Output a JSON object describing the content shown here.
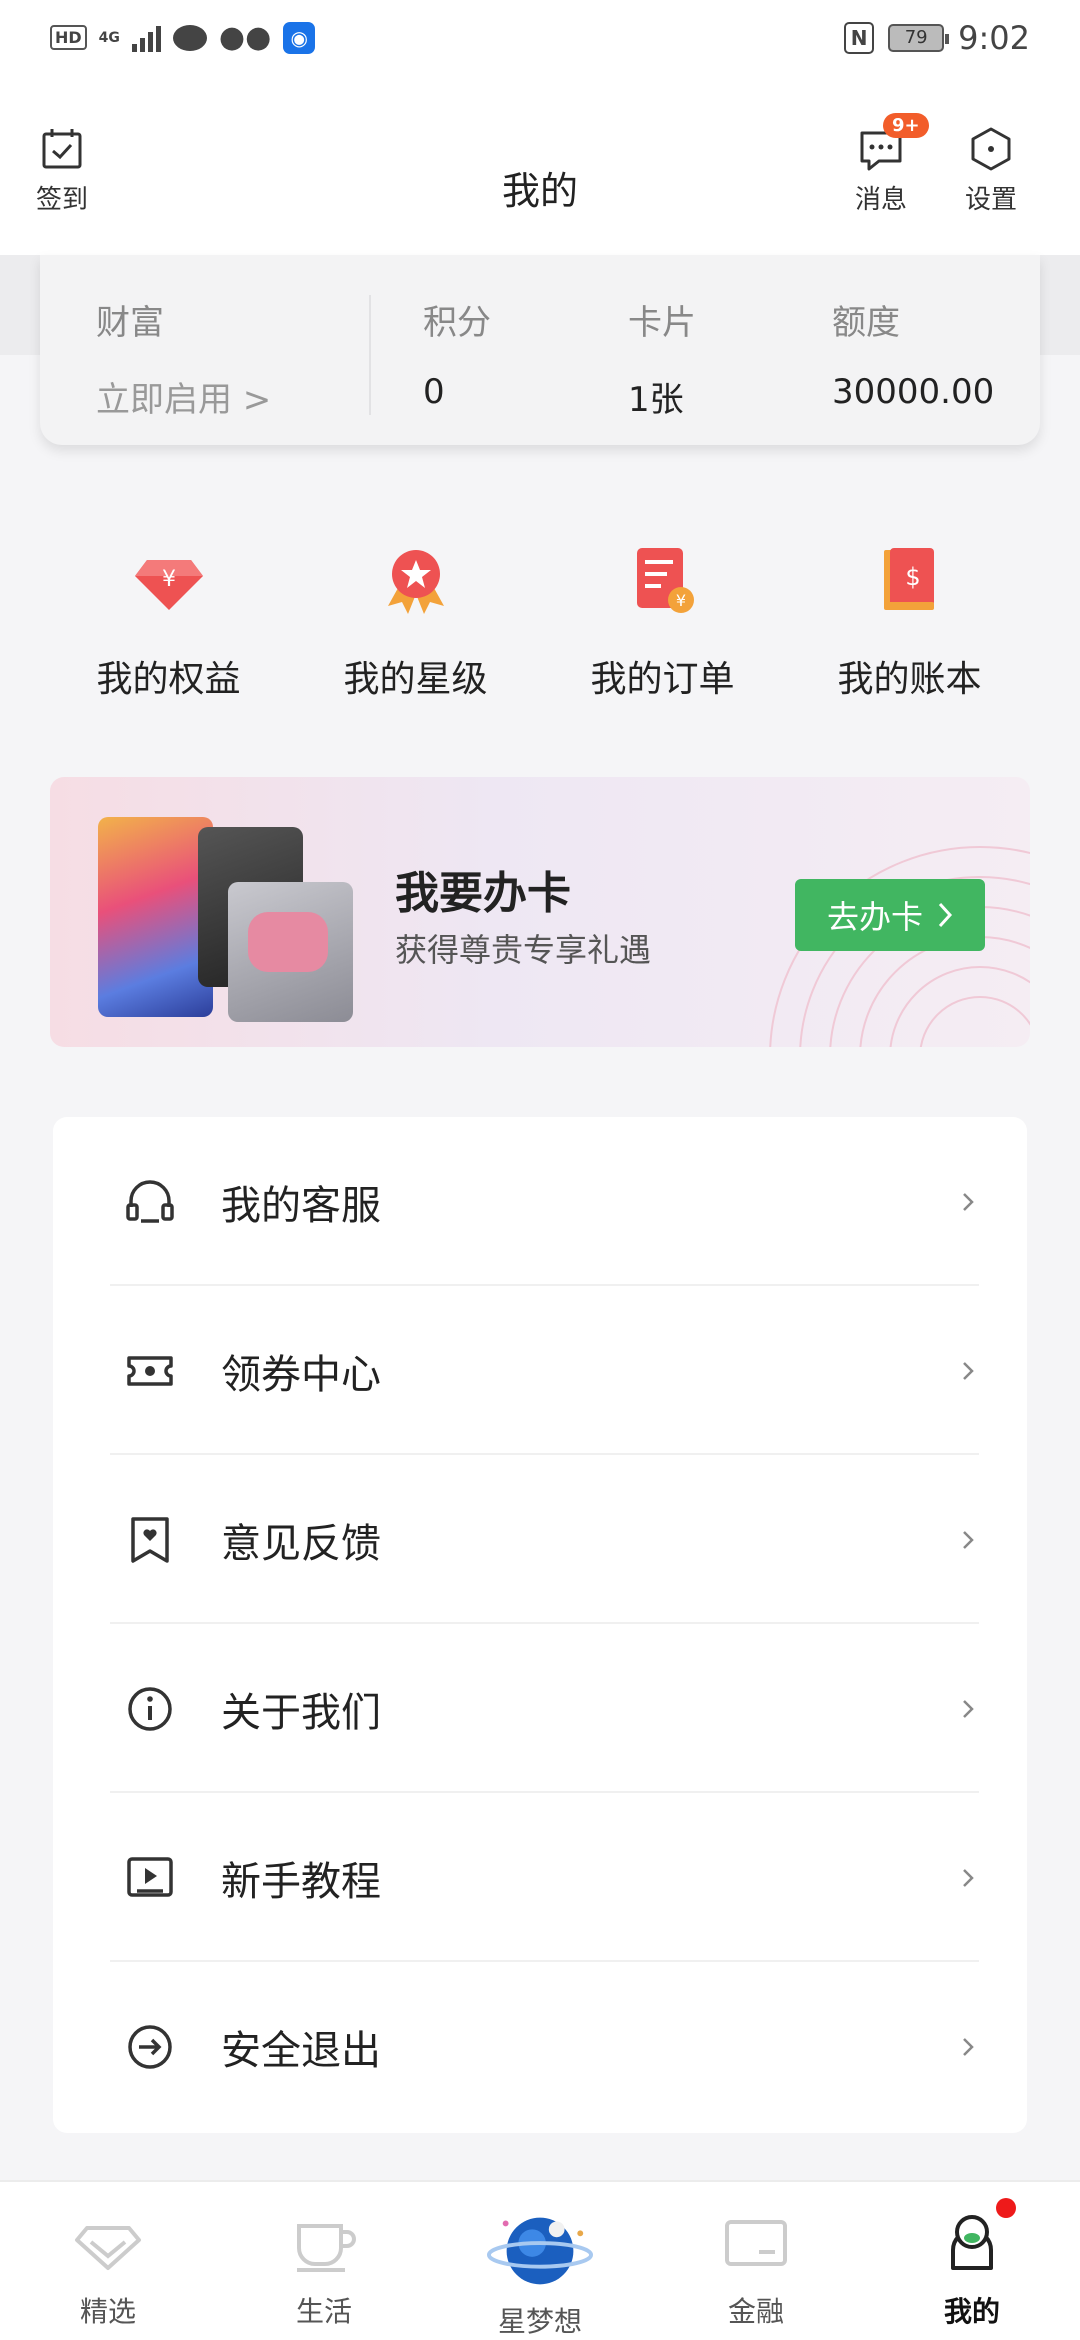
{
  "status_bar": {
    "left_label": "HD",
    "net_label": "4G",
    "battery": "79",
    "time": "9:02",
    "icons": [
      "signal-icon",
      "message-bubble-icon",
      "wechat-icon",
      "bulb-app-icon",
      "nfc-icon",
      "battery-icon"
    ]
  },
  "header": {
    "title": "我的",
    "checkin_label": "签到",
    "message_label": "消息",
    "message_badge": "9+",
    "settings_label": "设置"
  },
  "stats": {
    "wealth_label": "财富",
    "wealth_action": "立即启用 >",
    "points_label": "积分",
    "points_value": "0",
    "cards_label": "卡片",
    "cards_value": "1张",
    "limit_label": "额度",
    "limit_value": "30000.00"
  },
  "quick_actions": [
    {
      "label": "我的权益",
      "icon": "benefits-gem-icon"
    },
    {
      "label": "我的星级",
      "icon": "star-medal-icon"
    },
    {
      "label": "我的订单",
      "icon": "order-receipt-icon"
    },
    {
      "label": "我的账本",
      "icon": "ledger-book-icon"
    }
  ],
  "banner": {
    "title": "我要办卡",
    "subtitle": "获得尊贵专享礼遇",
    "button_label": "去办卡"
  },
  "menu": [
    {
      "label": "我的客服",
      "icon": "headset-icon"
    },
    {
      "label": "领券中心",
      "icon": "coupon-icon"
    },
    {
      "label": "意见反馈",
      "icon": "feedback-icon"
    },
    {
      "label": "关于我们",
      "icon": "info-icon"
    },
    {
      "label": "新手教程",
      "icon": "tutorial-icon"
    },
    {
      "label": "安全退出",
      "icon": "logout-icon"
    }
  ],
  "bottom_nav": [
    {
      "label": "精选",
      "icon": "featured-diamond-icon"
    },
    {
      "label": "生活",
      "icon": "life-cup-icon"
    },
    {
      "label": "星梦想",
      "icon": "planet-icon"
    },
    {
      "label": "金融",
      "icon": "finance-card-icon"
    },
    {
      "label": "我的",
      "icon": "profile-icon",
      "active": true
    }
  ],
  "colors": {
    "accent_green": "#41b661",
    "badge_orange": "#f25d2a",
    "icon_red": "#ee5252",
    "icon_orange": "#f39a3a",
    "nav_dot": "#ee1a1a"
  }
}
